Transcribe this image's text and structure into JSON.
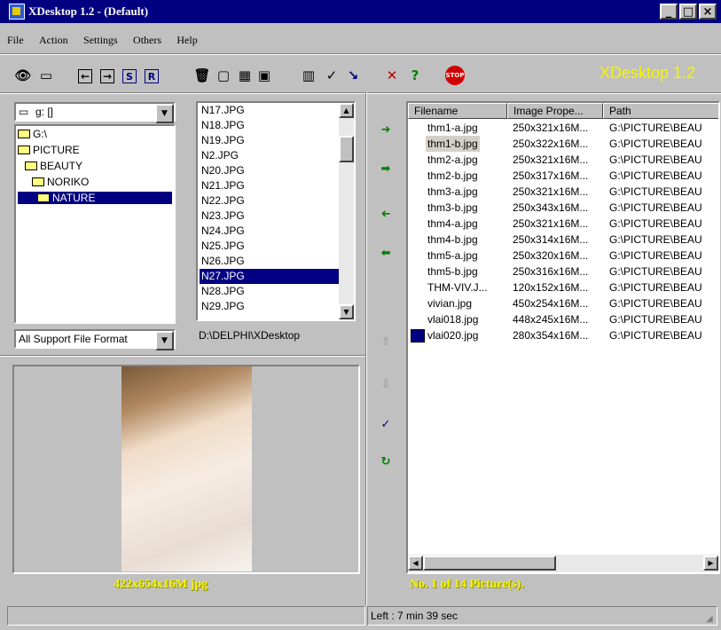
{
  "window": {
    "title": "XDesktop 1.2 - (Default)",
    "minimize": "_",
    "maximize": "□",
    "close": "×"
  },
  "menu": [
    "File",
    "Action",
    "Settings",
    "Others",
    "Help"
  ],
  "brand": "XDesktop 1.2",
  "toolbar_icons": [
    "view-icon",
    "slideshow-icon",
    "prev-icon",
    "next-icon",
    "s-icon",
    "r-icon",
    "delete-icon",
    "window-icon",
    "tile-icon",
    "monitor-icon",
    "books-icon",
    "tools-icon",
    "sort-icon",
    "close-x-icon",
    "help-icon",
    "stop-icon"
  ],
  "drive_select": {
    "value": "g: []"
  },
  "folder_tree": [
    {
      "label": "G:\\",
      "level": 0
    },
    {
      "label": "PICTURE",
      "level": 0
    },
    {
      "label": "BEAUTY",
      "level": 1
    },
    {
      "label": "NORIKO",
      "level": 2
    },
    {
      "label": "NATURE",
      "level": 3,
      "selected": true
    }
  ],
  "file_filter": {
    "value": "All Support File Format"
  },
  "file_list": {
    "items": [
      "N17.JPG",
      "N18.JPG",
      "N19.JPG",
      "N2.JPG",
      "N20.JPG",
      "N21.JPG",
      "N22.JPG",
      "N23.JPG",
      "N24.JPG",
      "N25.JPG",
      "N26.JPG",
      "N27.JPG",
      "N28.JPG",
      "N29.JPG"
    ],
    "selected": "N27.JPG"
  },
  "current_path": "D:\\DELPHI\\XDesktop",
  "preview": {
    "caption": "422x654x16M jpg"
  },
  "pictures_table": {
    "columns": [
      "Filename",
      "Image Prope...",
      "Path"
    ],
    "rows": [
      {
        "filename": "thm1-a.jpg",
        "props": "250x321x16M...",
        "path": "G:\\PICTURE\\BEAU"
      },
      {
        "filename": "thm1-b.jpg",
        "props": "250x322x16M...",
        "path": "G:\\PICTURE\\BEAU",
        "highlighted": true
      },
      {
        "filename": "thm2-a.jpg",
        "props": "250x321x16M...",
        "path": "G:\\PICTURE\\BEAU"
      },
      {
        "filename": "thm2-b.jpg",
        "props": "250x317x16M...",
        "path": "G:\\PICTURE\\BEAU"
      },
      {
        "filename": "thm3-a.jpg",
        "props": "250x321x16M...",
        "path": "G:\\PICTURE\\BEAU"
      },
      {
        "filename": "thm3-b.jpg",
        "props": "250x343x16M...",
        "path": "G:\\PICTURE\\BEAU"
      },
      {
        "filename": "thm4-a.jpg",
        "props": "250x321x16M...",
        "path": "G:\\PICTURE\\BEAU"
      },
      {
        "filename": "thm4-b.jpg",
        "props": "250x314x16M...",
        "path": "G:\\PICTURE\\BEAU"
      },
      {
        "filename": "thm5-a.jpg",
        "props": "250x320x16M...",
        "path": "G:\\PICTURE\\BEAU"
      },
      {
        "filename": "thm5-b.jpg",
        "props": "250x316x16M...",
        "path": "G:\\PICTURE\\BEAU"
      },
      {
        "filename": "THM-VIV.J...",
        "props": "120x152x16M...",
        "path": "G:\\PICTURE\\BEAU"
      },
      {
        "filename": "vivian.jpg",
        "props": "450x254x16M...",
        "path": "G:\\PICTURE\\BEAU"
      },
      {
        "filename": "vlai018.jpg",
        "props": "448x245x16M...",
        "path": "G:\\PICTURE\\BEAU"
      },
      {
        "filename": "vlai020.jpg",
        "props": "280x354x16M...",
        "path": "G:\\PICTURE\\BEAU",
        "icon": "monitor-icon"
      }
    ],
    "caption": "No. 1 of 14 Picture(s)."
  },
  "status": {
    "left": "",
    "right": "Left : 7 min 39 sec"
  },
  "colors": {
    "titlebar": "#000080",
    "selection": "#000080",
    "caption_yellow": "#f5f500",
    "face": "#c0c0c0"
  }
}
